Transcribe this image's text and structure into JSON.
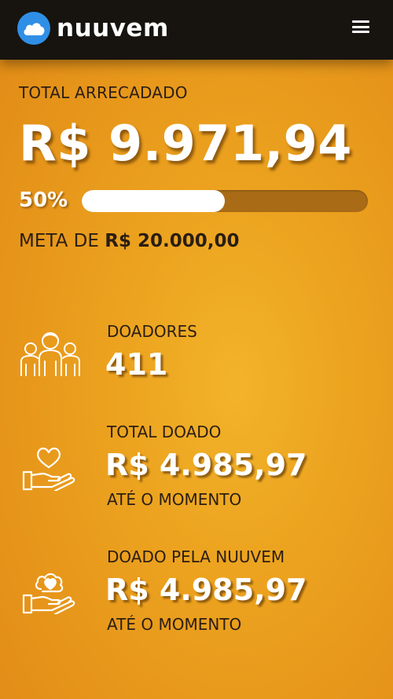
{
  "header": {
    "brand": "nuuvem",
    "logo_icon": "cloud-icon",
    "menu_icon": "hamburger-icon"
  },
  "totals": {
    "label": "TOTAL ARRECADADO",
    "amount": "R$ 9.971,94",
    "percent_label": "50%",
    "progress_fraction": 0.5,
    "goal_prefix": "META DE ",
    "goal_amount": "R$ 20.000,00"
  },
  "stats": {
    "donors": {
      "label": "DOADORES",
      "value": "411",
      "icon": "people-group-icon"
    },
    "total_donated": {
      "label": "TOTAL DOADO",
      "value": "R$ 4.985,97",
      "sub": "ATÉ O MOMENTO",
      "icon": "hand-heart-icon"
    },
    "nuuvem_donated": {
      "label": "DOADO PELA NUUVEM",
      "value": "R$ 4.985,97",
      "sub": "ATÉ O MOMENTO",
      "icon": "hand-cloud-heart-icon"
    }
  },
  "colors": {
    "header_bg": "#17140f",
    "background": "#eca31f",
    "logo_blue": "#2f8fe6",
    "track": "#a96b16",
    "text_dark": "#2a1e14",
    "text_light": "#ffffff"
  }
}
